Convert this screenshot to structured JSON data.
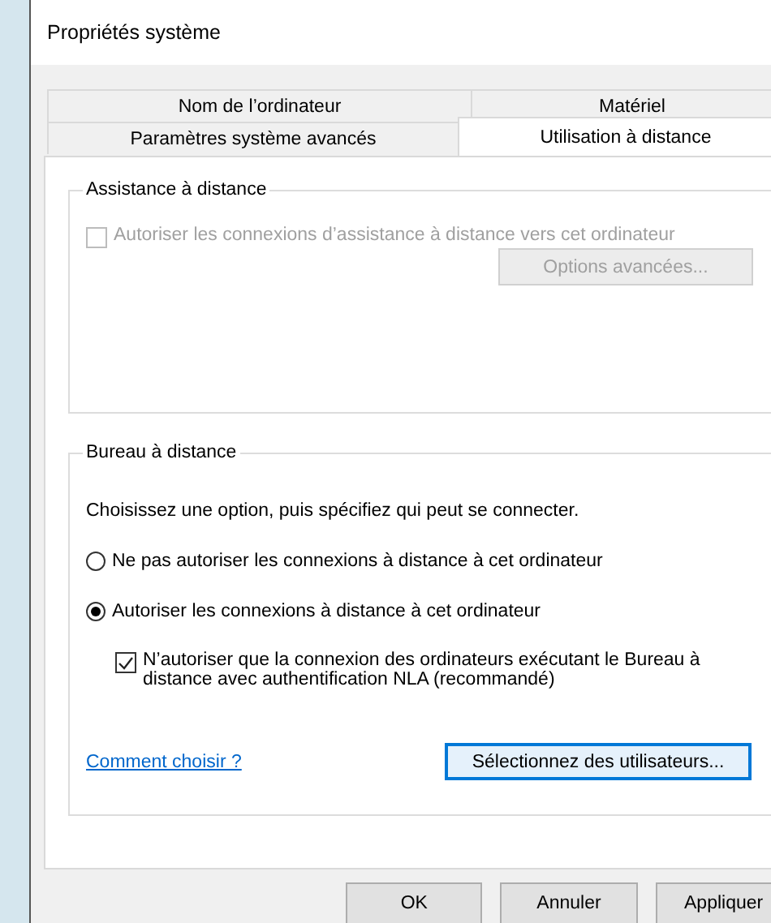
{
  "window": {
    "title": "Propriétés système"
  },
  "tab_rows": [
    {
      "tabs": [
        {
          "label": "Nom de l’ordinateur",
          "selected": false
        },
        {
          "label": "Matériel",
          "selected": false
        }
      ]
    },
    {
      "tabs": [
        {
          "label": "Paramètres système avancés",
          "selected": false
        },
        {
          "label": "Utilisation à distance",
          "selected": true
        }
      ]
    }
  ],
  "remote_assistance": {
    "title": "Assistance à distance",
    "checkbox": {
      "label": "Autoriser les connexions d’assistance à distance vers cet ordinateur",
      "checked": false,
      "disabled": true
    },
    "advanced_button": {
      "label": "Options avancées...",
      "disabled": true
    }
  },
  "remote_desktop": {
    "title": "Bureau à distance",
    "instruction": "Choisissez une option, puis spécifiez qui peut se connecter.",
    "options": [
      {
        "label": "Ne pas autoriser les connexions à distance à cet ordinateur",
        "selected": false
      },
      {
        "label": "Autoriser les connexions à distance à cet ordinateur",
        "selected": true
      }
    ],
    "nla_checkbox": {
      "label": "N’autoriser que la connexion des ordinateurs exécutant le Bureau à distance avec authentification NLA (recommandé)",
      "checked": true,
      "disabled": false
    },
    "help_link": "Comment choisir ?",
    "select_users_button": {
      "label": "Sélectionnez des utilisateurs...",
      "disabled": false
    }
  },
  "buttons": [
    {
      "label": "OK"
    },
    {
      "label": "Annuler"
    },
    {
      "label": "Appliquer"
    }
  ]
}
